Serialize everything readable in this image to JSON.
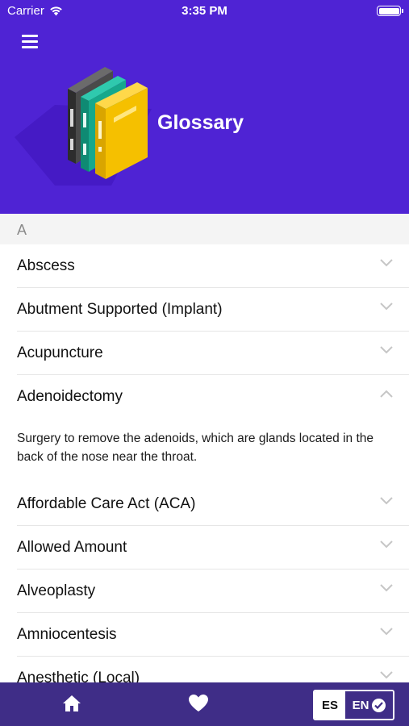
{
  "status_bar": {
    "carrier": "Carrier",
    "time": "3:35 PM",
    "battery_level": 1.0
  },
  "header": {
    "title": "Glossary",
    "menu_icon": "hamburger-menu-icon",
    "illustration": "books-illustration",
    "background_color": "#4f23d4"
  },
  "section": {
    "letter": "A"
  },
  "glossary": {
    "items": [
      {
        "term": "Abscess",
        "expanded": false
      },
      {
        "term": "Abutment Supported (Implant)",
        "expanded": false
      },
      {
        "term": "Acupuncture",
        "expanded": false
      },
      {
        "term": "Adenoidectomy",
        "expanded": true,
        "definition": "Surgery to remove the adenoids, which are glands located in the back of the nose near the throat."
      },
      {
        "term": "Affordable Care Act (ACA)",
        "expanded": false
      },
      {
        "term": "Allowed Amount",
        "expanded": false
      },
      {
        "term": "Alveoplasty",
        "expanded": false
      },
      {
        "term": "Amniocentesis",
        "expanded": false
      },
      {
        "term": "Anesthetic (Local)",
        "expanded": false
      }
    ]
  },
  "tab_bar": {
    "home_icon": "home-icon",
    "favorites_icon": "heart-icon",
    "language": {
      "es_label": "ES",
      "en_label": "EN",
      "selected": "EN"
    },
    "background_color": "#3f2d87"
  }
}
